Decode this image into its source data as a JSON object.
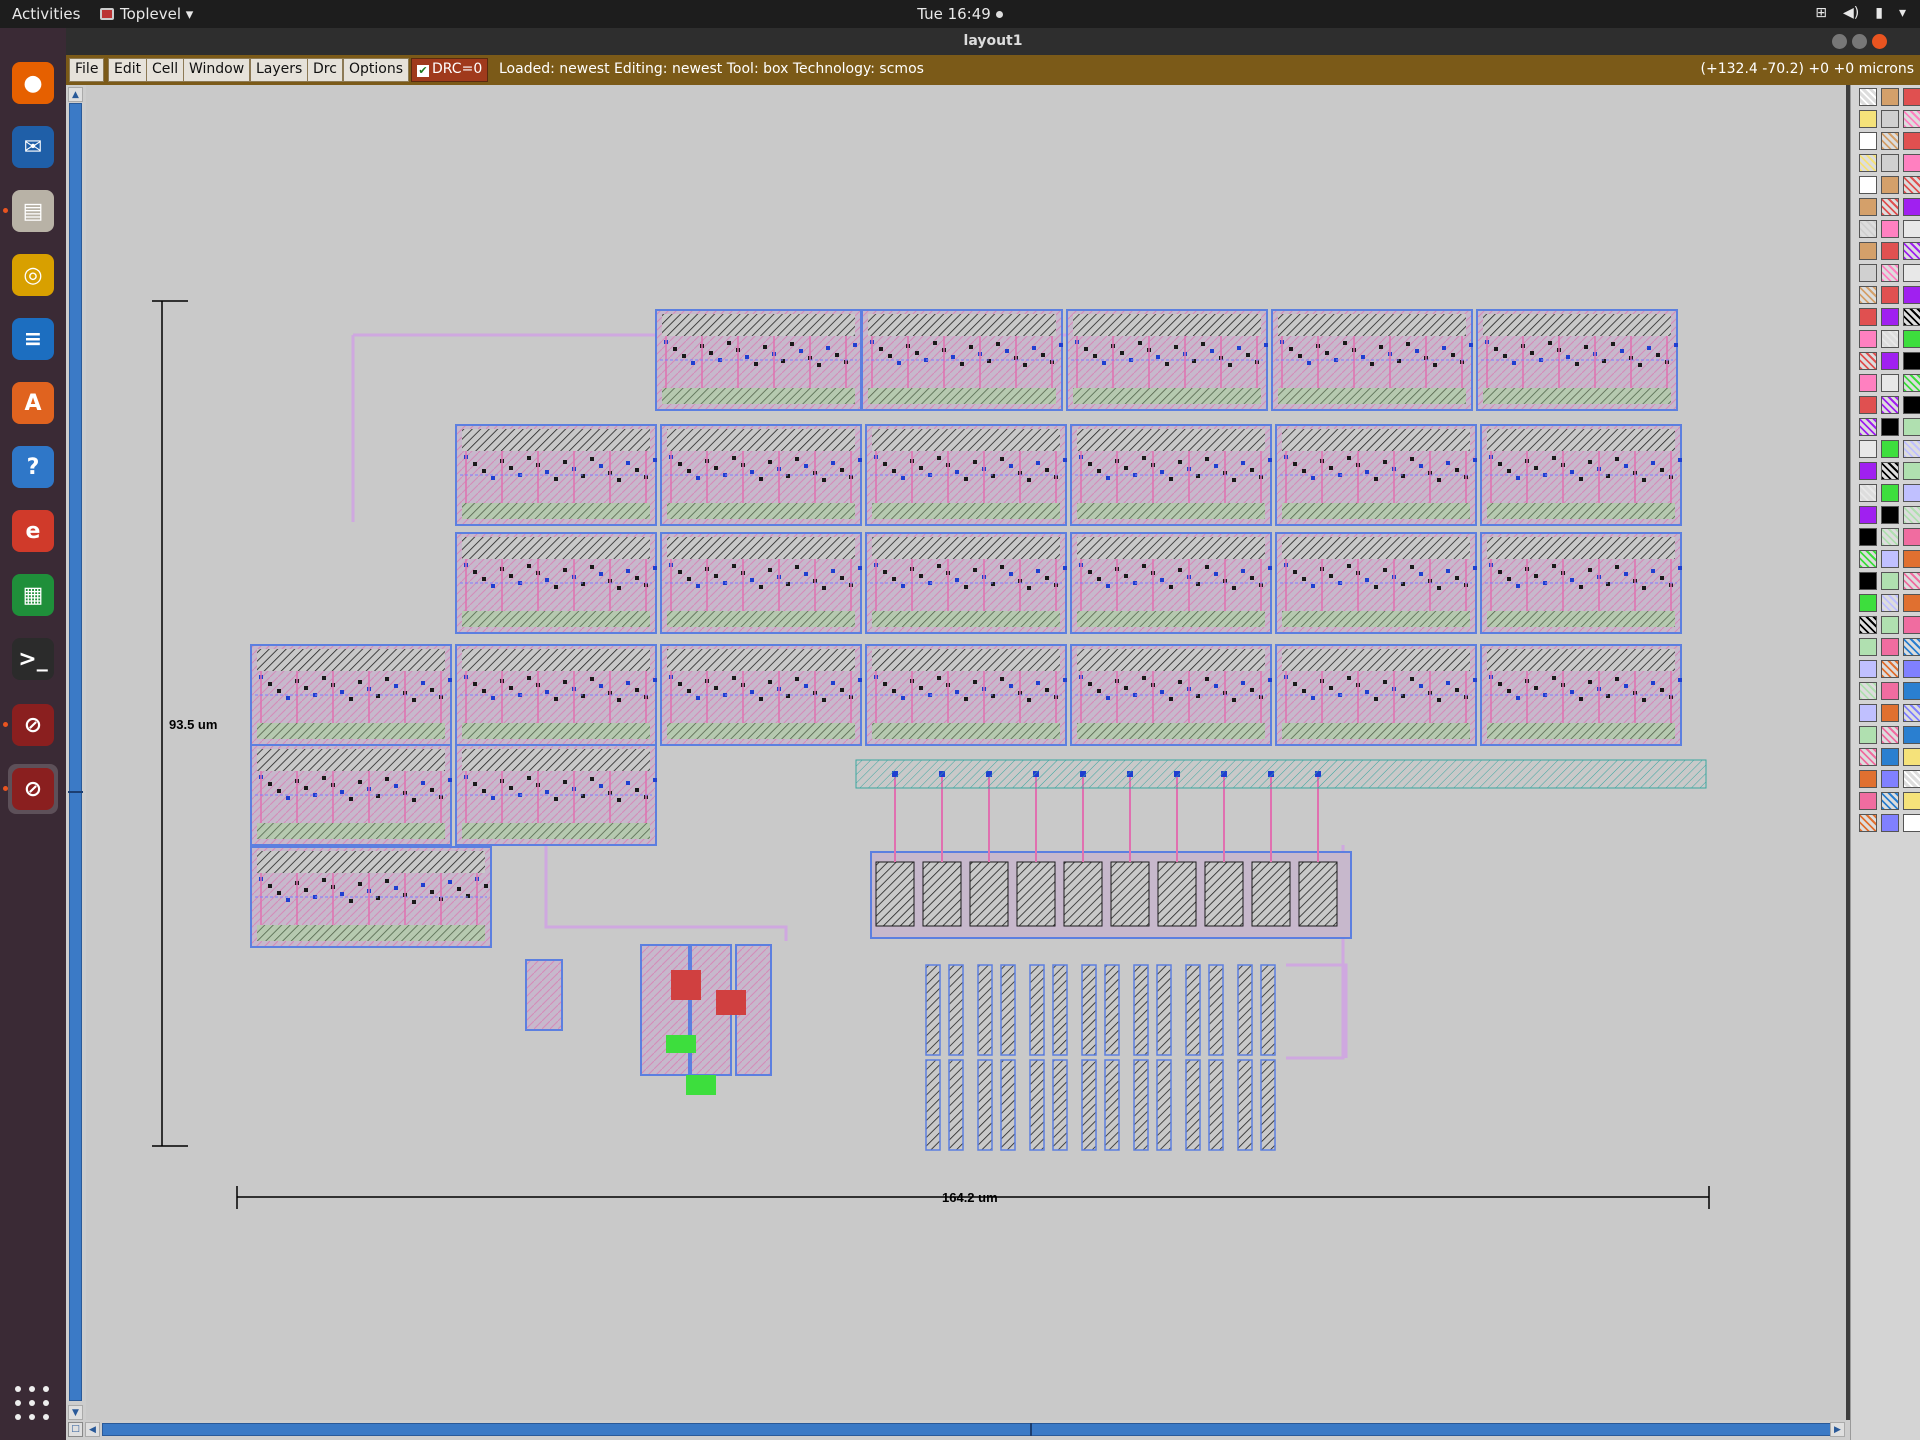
{
  "topbar": {
    "activities": "Activities",
    "app_menu": "Toplevel",
    "clock": "Tue 16:49"
  },
  "dock": {
    "items": [
      {
        "name": "firefox-icon",
        "color": "#e66000",
        "glyph": "●",
        "running": false
      },
      {
        "name": "thunderbird-icon",
        "color": "#1f5fa8",
        "glyph": "✉",
        "running": false
      },
      {
        "name": "files-icon",
        "color": "#b8b2a6",
        "glyph": "▤",
        "running": true
      },
      {
        "name": "rhythmbox-icon",
        "color": "#d8a000",
        "glyph": "◎",
        "running": false
      },
      {
        "name": "writer-icon",
        "color": "#1c6ec0",
        "glyph": "≡",
        "running": false
      },
      {
        "name": "software-icon",
        "color": "#e0631f",
        "glyph": "A",
        "running": false
      },
      {
        "name": "help-icon",
        "color": "#2f77c8",
        "glyph": "?",
        "running": false
      },
      {
        "name": "evince-icon",
        "color": "#d03a2a",
        "glyph": "e",
        "running": false
      },
      {
        "name": "calc-icon",
        "color": "#1f8f3a",
        "glyph": "▦",
        "running": false
      },
      {
        "name": "terminal-icon",
        "color": "#2b2b2b",
        "glyph": ">_",
        "running": false
      },
      {
        "name": "magic-icon",
        "color": "#8a1f1f",
        "glyph": "⊘",
        "running": true
      },
      {
        "name": "magic-layout-icon",
        "color": "#8a1f1f",
        "glyph": "⊘",
        "running": true
      }
    ]
  },
  "window": {
    "title": "layout1"
  },
  "menubar": {
    "items": [
      "File",
      "Edit",
      "Cell",
      "Window",
      "Layers",
      "Drc",
      "Options"
    ],
    "drc_label": "DRC=0",
    "status": "Loaded: newest  Editing: newest  Tool: box   Technology: scmos",
    "coords": "(+132.4 -70.2) +0 +0 microns"
  },
  "canvas": {
    "vertical_scale_label": "93.5 um",
    "horizontal_scale_label": "164.2 um"
  },
  "palette": {
    "colors": [
      "#ffffff",
      "#e8e8e8",
      "#f06ca0",
      "#d4a06a",
      "#3dde3d",
      "#2a7fd0",
      "#e05050",
      "#c0c0ff",
      "#f5e27a",
      "#a020f0",
      "#e07030",
      "#d0d0d0",
      "#000000",
      "#8080ff",
      "#ff80c0",
      "#b0e0b0"
    ]
  }
}
